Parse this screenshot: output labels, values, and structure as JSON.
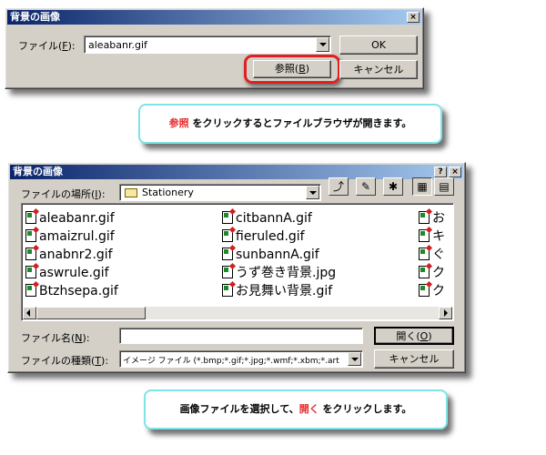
{
  "dialog1": {
    "title": "背景の画像",
    "close": "×",
    "file_label_text": "ファイル(",
    "file_label_key": "F",
    "file_label_end": "):",
    "file_value": "aleabanr.gif",
    "ok": "OK",
    "browse_text": "参照(",
    "browse_key": "B",
    "browse_end": ")",
    "cancel": "キャンセル"
  },
  "callout1": {
    "highlight": "参照",
    "text": " をクリックするとファイルブラウザが開きます。"
  },
  "dialog2": {
    "title": "背景の画像",
    "help": "?",
    "close": "×",
    "lookin_text": "ファイルの場所(",
    "lookin_key": "I",
    "lookin_end": "):",
    "folder": "Stationery",
    "files": [
      {
        "name": "aleabanr.gif"
      },
      {
        "name": "amaizrul.gif"
      },
      {
        "name": "anabnr2.gif"
      },
      {
        "name": "aswrule.gif"
      },
      {
        "name": "Btzhsepa.gif"
      },
      {
        "name": "citbannA.gif"
      },
      {
        "name": "fieruled.gif"
      },
      {
        "name": "sunbannA.gif"
      },
      {
        "name": "うず巻き背景.jpg"
      },
      {
        "name": "お見舞い背景.gif"
      },
      {
        "name": "お"
      },
      {
        "name": "キ"
      },
      {
        "name": "ぐ"
      },
      {
        "name": "ク"
      },
      {
        "name": "ク"
      }
    ],
    "filename_text": "ファイル名(",
    "filename_key": "N",
    "filename_end": "):",
    "filename_value": "",
    "open_text": "開く(",
    "open_key": "O",
    "open_end": ")",
    "filetype_text": "ファイルの種類(",
    "filetype_key": "T",
    "filetype_end": "):",
    "filetype_value": "イメージ ファイル (*.bmp;*.gif;*.jpg;*.wmf;*.xbm;*.art",
    "cancel": "キャンセル"
  },
  "callout2": {
    "text_before": "画像ファイルを選択して、",
    "highlight": "開く",
    "text_after": " をクリックします。"
  },
  "colors": {
    "title_bar_start": "#0a246a",
    "highlight_text": "#e4292d",
    "callout_border": "#7fe3ea",
    "browse_ring": "#e02020"
  }
}
